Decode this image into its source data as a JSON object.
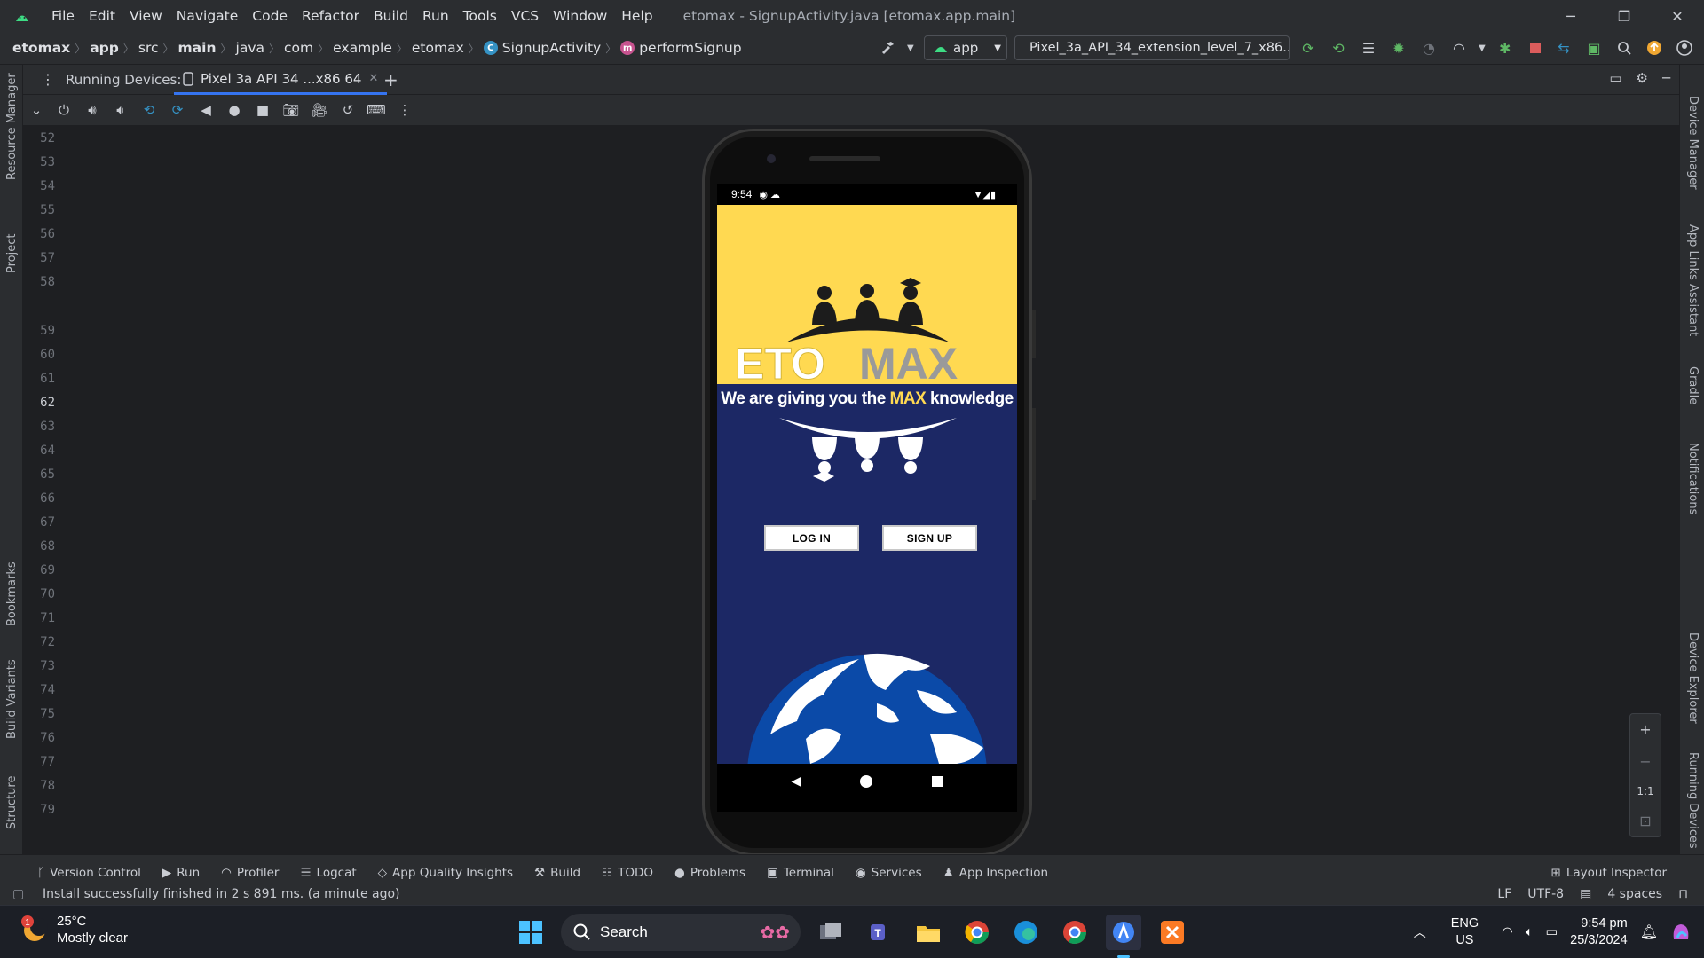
{
  "window": {
    "title": "etomax - SignupActivity.java [etomax.app.main]",
    "menu": [
      "File",
      "Edit",
      "View",
      "Navigate",
      "Code",
      "Refactor",
      "Build",
      "Run",
      "Tools",
      "VCS",
      "Window",
      "Help"
    ],
    "controls": {
      "minimize": "─",
      "restore": "❐",
      "close": "✕"
    }
  },
  "breadcrumb": [
    "etomax",
    "app",
    "src",
    "main",
    "java",
    "com",
    "example",
    "etomax",
    "SignupActivity",
    "performSignup"
  ],
  "run_config": {
    "label": "app"
  },
  "device_config": {
    "label": "Pixel_3a_API_34_extension_level_7_x86..."
  },
  "running_devices": {
    "label": "Running Devices:",
    "tab_label": "Pixel 3a API 34 ...x86 64",
    "add": "+"
  },
  "left_stripe": [
    "Resource Manager",
    "Project",
    "Bookmarks",
    "Build Variants",
    "Structure"
  ],
  "right_stripe": [
    "Device Manager",
    "App Links Assistant",
    "Gradle",
    "Notifications",
    "Device Explorer",
    "Running Devices"
  ],
  "line_numbers": [
    "52",
    "53",
    "54",
    "55",
    "56",
    "57",
    "58",
    "59",
    "60",
    "61",
    "62",
    "63",
    "64",
    "65",
    "66",
    "67",
    "68",
    "69",
    "70",
    "71",
    "72",
    "73",
    "74",
    "75",
    "76",
    "77",
    "78",
    "79"
  ],
  "current_line": "62",
  "zoom": {
    "in": "+",
    "out": "−",
    "actual": "1:1"
  },
  "phone": {
    "time": "9:54",
    "brand": "ETOMAX",
    "brand_part1": "ETO",
    "brand_part2": "MAX",
    "tagline_a": "We are giving you the ",
    "tagline_max": "MAX",
    "tagline_b": " knowledge",
    "login_button": "LOG IN",
    "signup_button": "SIGN UP",
    "colors": {
      "top": "#ffd951",
      "bottom": "#1c2865",
      "globe": "#0b4aa8"
    }
  },
  "bottom_tools": [
    "Version Control",
    "Run",
    "Profiler",
    "Logcat",
    "App Quality Insights",
    "Build",
    "TODO",
    "Problems",
    "Terminal",
    "Services",
    "App Inspection"
  ],
  "layout_inspector": "Layout Inspector",
  "status": {
    "message": "Install successfully finished in 2 s 891 ms. (a minute ago)",
    "line_sep": "LF",
    "encoding": "UTF-8",
    "indent": "4 spaces"
  },
  "taskbar": {
    "weather_temp": "25°C",
    "weather_desc": "Mostly clear",
    "weather_badge": "1",
    "search_label": "Search",
    "lang_top": "ENG",
    "lang_bottom": "US",
    "time": "9:54 pm",
    "date": "25/3/2024"
  }
}
